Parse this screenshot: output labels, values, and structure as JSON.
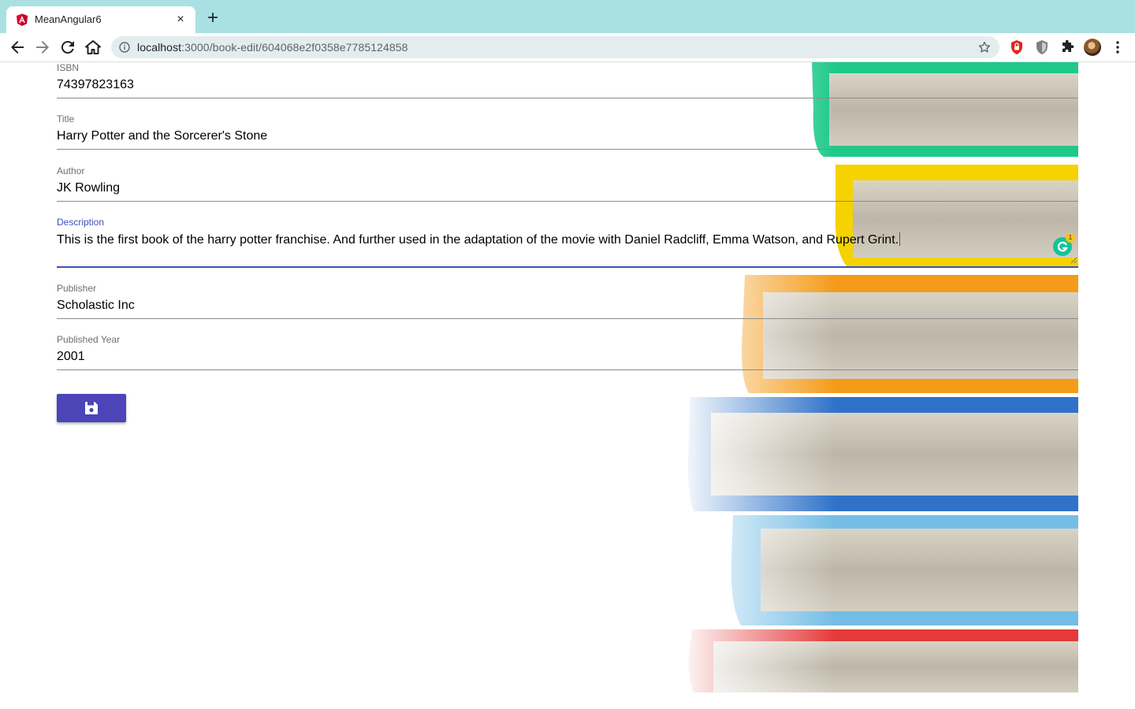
{
  "browser": {
    "tab": {
      "title": "MeanAngular6",
      "favicon": "angular-logo-icon",
      "close_icon": "×"
    },
    "new_tab_icon": "+",
    "url_host": "localhost",
    "url_path": ":3000/book-edit/604068e2f0358e7785124858",
    "icons": [
      "back-icon",
      "forward-icon",
      "reload-icon",
      "home-icon",
      "site-info-icon",
      "bookmark-star-icon",
      "extension-shield-red-icon",
      "extension-shield-gray-icon",
      "extensions-puzzle-icon",
      "profile-avatar",
      "menu-kebab-icon"
    ]
  },
  "form": {
    "isbn": {
      "label": "ISBN",
      "value": "74397823163"
    },
    "title": {
      "label": "Title",
      "value": "Harry Potter and the Sorcerer's Stone"
    },
    "author": {
      "label": "Author",
      "value": "JK Rowling"
    },
    "description": {
      "label": "Description",
      "value": "This is the first book of the harry potter franchise. And further used in the adaptation of the movie with Daniel Radcliff, Emma Watson, and Rupert Grint."
    },
    "publisher": {
      "label": "Publisher",
      "value": "Scholastic Inc"
    },
    "published_year": {
      "label": "Published Year",
      "value": "2001"
    }
  },
  "save_button": {
    "icon": "save-floppy-icon"
  },
  "grammarly": {
    "badge_count": "1"
  },
  "colors": {
    "accent": "#3f51b5",
    "button": "#4b45b8",
    "tabstrip": "#a9e1e3"
  }
}
